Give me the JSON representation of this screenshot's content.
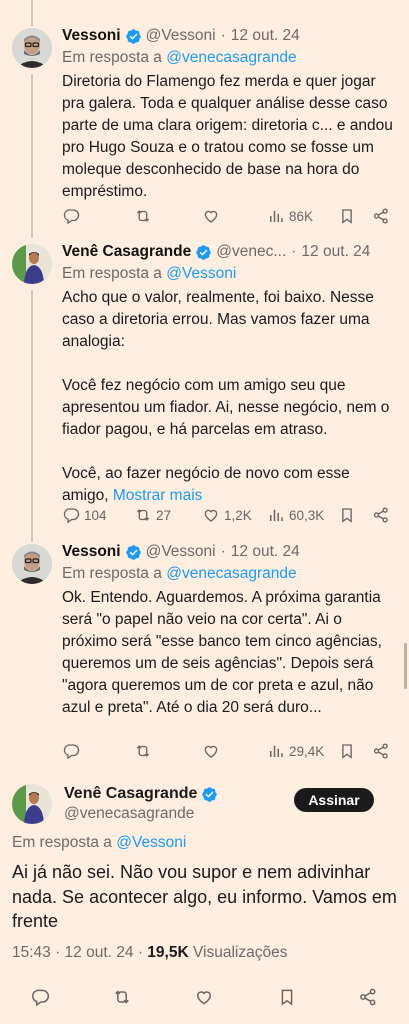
{
  "tweets": [
    {
      "name": "Vessoni",
      "handle": "@Vessoni",
      "time": "12 out. 24",
      "reply_prefix": "Em resposta a ",
      "reply_to": "@venecasagrande",
      "text": "Diretoria do Flamengo fez merda e quer jogar pra galera. Toda e qualquer análise desse caso parte de uma clara origem: diretoria c... e andou pro Hugo Souza e o tratou como se fosse um moleque desconhecido de base na hora do empréstimo.",
      "more": "",
      "replies": "",
      "retweets": "",
      "likes": "",
      "views": "86K"
    },
    {
      "name": "Venê Casagrande",
      "handle": "@venec...",
      "time": "12 out. 24",
      "reply_prefix": "Em resposta a ",
      "reply_to": "@Vessoni",
      "text": "Acho que o valor, realmente, foi baixo. Nesse caso a diretoria errou. Mas vamos fazer uma analogia:\n\nVocê fez negócio com um amigo seu que apresentou um fiador. Ai, nesse negócio, nem o fiador pagou, e há parcelas em atraso.\n\nVocê, ao fazer negócio de novo com esse amigo, ",
      "more": "Mostrar mais",
      "replies": "104",
      "retweets": "27",
      "likes": "1,2K",
      "views": "60,3K"
    },
    {
      "name": "Vessoni",
      "handle": "@Vessoni",
      "time": "12 out. 24",
      "reply_prefix": "Em resposta a ",
      "reply_to": "@venecasagrande",
      "text": "Ok. Entendo. Aguardemos. A próxima garantia será \"o papel não veio na cor certa\". Ai o próximo será \"esse banco tem cinco agências, queremos um de seis agências\". Depois será \"agora queremos um de cor preta e azul, não azul e preta\". Até o dia 20 será duro...",
      "more": "",
      "replies": "",
      "retweets": "",
      "likes": "",
      "views": "29,4K"
    }
  ],
  "main_tweet": {
    "name": "Venê Casagrande",
    "handle": "@venecasagrande",
    "subscribe_label": "Assinar",
    "reply_prefix": "Em resposta a ",
    "reply_to": "@Vessoni",
    "text": "Ai já não sei. Não vou supor e nem adivinhar nada. Se acontecer algo, eu informo. Vamos em frente",
    "time": "15:43 · 12 out. 24 · ",
    "views_count": "19,5K",
    "views_label": " Visualizações"
  },
  "colors": {
    "background": "#fdeee0",
    "link": "#1d9bf0",
    "verified": "#1d9bf0",
    "muted": "#6f6a66"
  },
  "icons": [
    "reply-icon",
    "retweet-icon",
    "like-icon",
    "views-icon",
    "bookmark-icon",
    "share-icon",
    "verified-badge-icon"
  ]
}
